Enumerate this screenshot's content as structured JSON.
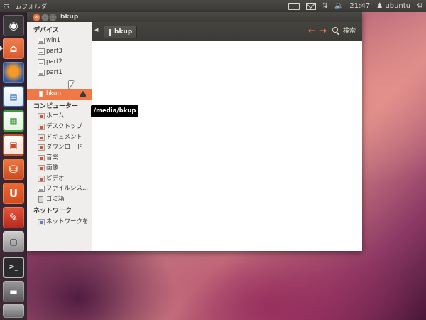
{
  "top_panel": {
    "app_title": "ホームフォルダー",
    "time": "21:47",
    "user": "ubuntu",
    "icons": [
      "keyboard-icon",
      "mail-icon",
      "network-icon",
      "volume-icon",
      "gear-icon"
    ]
  },
  "window": {
    "title": "bkup",
    "close_glyph": "×",
    "min_glyph": "–",
    "max_glyph": "□"
  },
  "toolbar": {
    "back_glyph": "◀",
    "path_label": "bkup",
    "nav_back_glyph": "←",
    "nav_forward_glyph": "→",
    "search_label": "検索"
  },
  "sidebar": {
    "devices_header": "デバイス",
    "devices": [
      {
        "label": "win1"
      },
      {
        "label": "part3"
      },
      {
        "label": "part2"
      },
      {
        "label": "part1"
      },
      {
        "label": "bkup",
        "selected": true
      }
    ],
    "computer_header": "コンピューター",
    "computer": [
      {
        "label": "ホーム"
      },
      {
        "label": "デスクトップ"
      },
      {
        "label": "ドキュメント"
      },
      {
        "label": "ダウンロード"
      },
      {
        "label": "音楽"
      },
      {
        "label": "画像"
      },
      {
        "label": "ビデオ"
      },
      {
        "label": "ファイルシス..."
      },
      {
        "label": "ゴミ箱"
      }
    ],
    "network_header": "ネットワーク",
    "network": [
      {
        "label": "ネットワークを..."
      }
    ]
  },
  "tooltip": {
    "text": "/media/bkup"
  },
  "launcher": {
    "items": [
      {
        "name": "dash-home-icon",
        "color": "#4a4a4a"
      },
      {
        "name": "home-folder-icon",
        "color": "#e7683a"
      },
      {
        "name": "firefox-icon",
        "color": "#2d5fa8"
      },
      {
        "name": "writer-icon",
        "color": "#2f6db5"
      },
      {
        "name": "calc-icon",
        "color": "#3e9b3b"
      },
      {
        "name": "impress-icon",
        "color": "#c0522a"
      },
      {
        "name": "software-center-icon",
        "color": "#d95a26"
      },
      {
        "name": "ubuntu-one-icon",
        "color": "#e15b2a"
      },
      {
        "name": "system-settings-icon",
        "color": "#c13c2a"
      },
      {
        "name": "workspaces-icon",
        "color": "#8a8a8a"
      },
      {
        "name": "terminal-icon",
        "color": "#2f2f2f"
      },
      {
        "name": "disk-icon",
        "color": "#6a6a6a"
      }
    ]
  }
}
